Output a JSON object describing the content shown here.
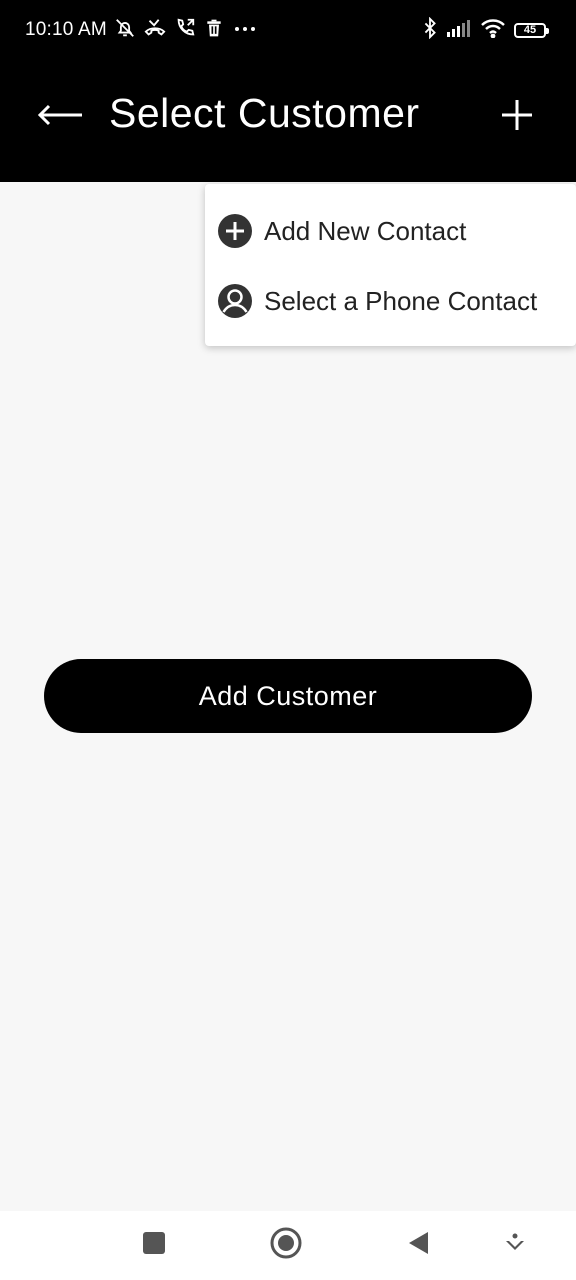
{
  "status_bar": {
    "time": "10:10 AM",
    "battery_level": "45",
    "icons_left": [
      "notification-off-icon",
      "missed-call-icon",
      "call-forward-icon",
      "trash-icon",
      "more-dots-icon"
    ],
    "icons_right": [
      "bluetooth-icon",
      "signal-icon",
      "wifi-icon",
      "battery-icon"
    ]
  },
  "app_bar": {
    "title": "Select Customer",
    "back_icon": "arrow-left-icon",
    "add_icon": "plus-icon"
  },
  "popup_menu": {
    "items": [
      {
        "label": "Add New Contact",
        "icon": "add-circle-icon"
      },
      {
        "label": "Select a Phone Contact",
        "icon": "person-circle-icon"
      }
    ]
  },
  "main": {
    "add_customer_label": "Add Customer"
  },
  "nav_bar": {
    "items": [
      "recents-square-icon",
      "home-circle-icon",
      "back-triangle-icon",
      "keyboard-hide-icon"
    ]
  },
  "colors": {
    "app_bar_bg": "#000000",
    "page_bg": "#f7f7f7",
    "menu_bg": "#ffffff",
    "icon_dark": "#333333"
  }
}
